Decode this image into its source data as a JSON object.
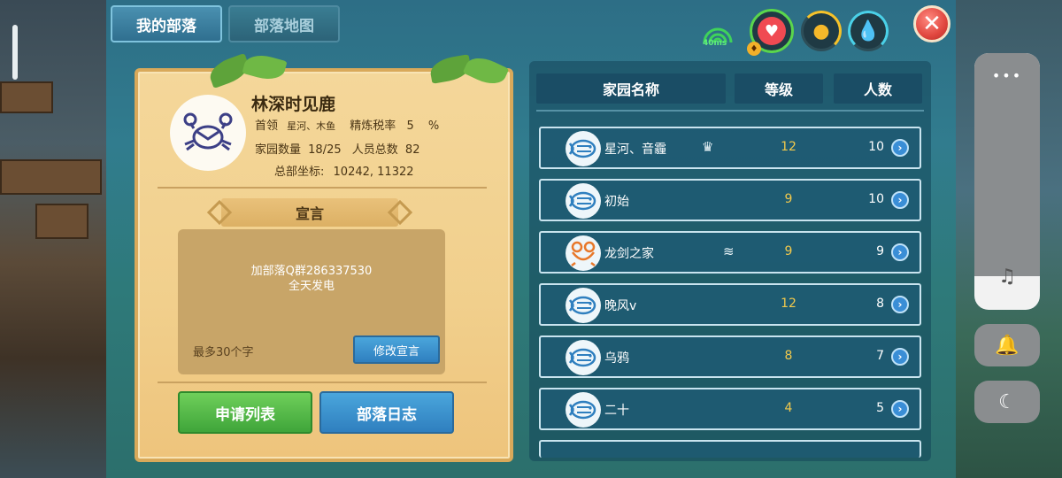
{
  "tabs": {
    "my_tribe": "我的部落",
    "tribe_map": "部落地图"
  },
  "status": {
    "ping": "40ms"
  },
  "tribe": {
    "name": "林深时见鹿",
    "leader_label": "首领",
    "leader_value": "星河、木鱼",
    "tax_label": "精炼税率",
    "tax_value": "5",
    "tax_unit": "%",
    "homes_label": "家园数量",
    "homes_value": "18/25",
    "members_label": "人员总数",
    "members_value": "82",
    "hq_label": "总部坐标:",
    "hq_value": "10242, 11322"
  },
  "declaration": {
    "title": "宣言",
    "line1": "加部落Q群286337530",
    "line2": "全天发电",
    "limit": "最多30个字",
    "edit_button": "修改宣言"
  },
  "actions": {
    "apply_list": "申请列表",
    "tribe_log": "部落日志"
  },
  "list": {
    "headers": {
      "name": "家园名称",
      "level": "等级",
      "count": "人数"
    },
    "rows": [
      {
        "name": "星河、音霾",
        "level": "12",
        "count": "10",
        "avatar": "fish-icon",
        "tag": "leader-icon"
      },
      {
        "name": "初始",
        "level": "9",
        "count": "10",
        "avatar": "fish-icon",
        "tag": ""
      },
      {
        "name": "龙剑之家",
        "level": "9",
        "count": "9",
        "avatar": "frog-icon",
        "tag": "elder-icon"
      },
      {
        "name": "晚风v",
        "level": "12",
        "count": "8",
        "avatar": "fish-icon",
        "tag": ""
      },
      {
        "name": "乌鸦",
        "level": "8",
        "count": "7",
        "avatar": "fish-icon",
        "tag": ""
      },
      {
        "name": "二十",
        "level": "4",
        "count": "5",
        "avatar": "fish-icon",
        "tag": ""
      }
    ]
  },
  "colors": {
    "level": "#f2c94c",
    "tab_active": "#2f6f8f",
    "panel": "#f1cf8c"
  }
}
